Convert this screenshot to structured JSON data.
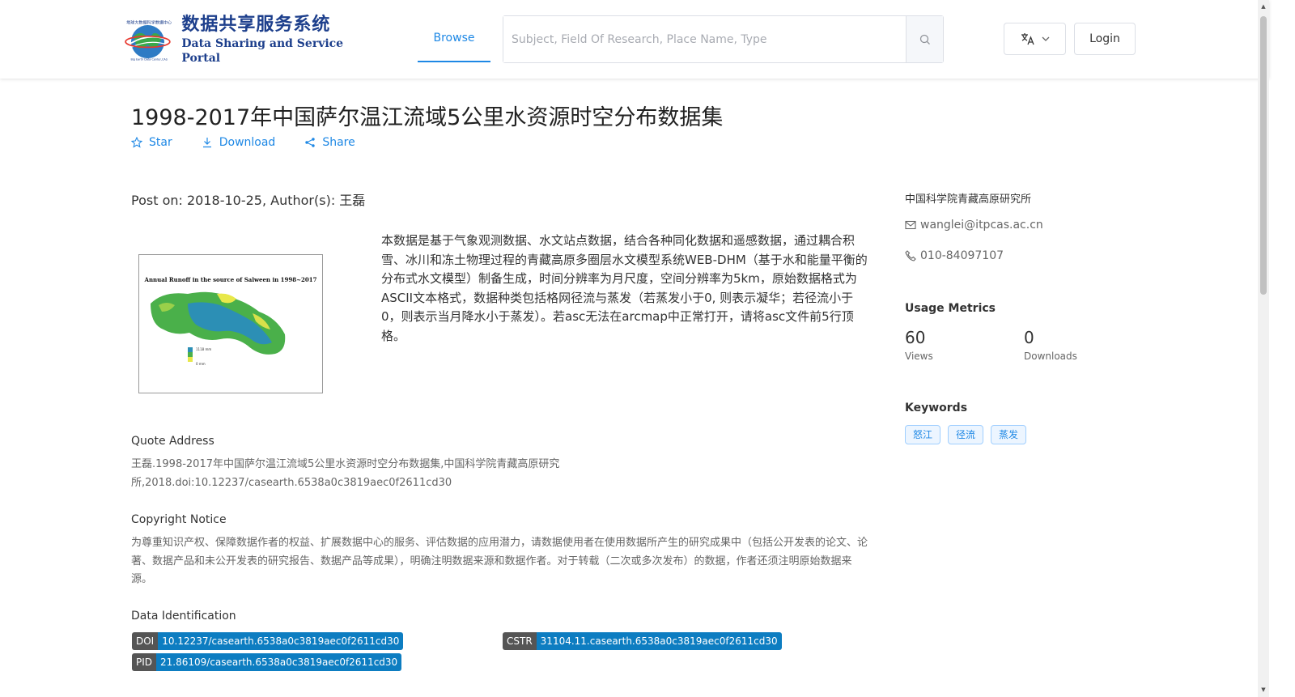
{
  "header": {
    "logo_cn": "数据共享服务系统",
    "logo_en": "Data Sharing and Service Portal",
    "logo_small_top": "地球大数据科学数据中心",
    "logo_small_bottom": "Big Earth Data Center,CAS",
    "nav_browse": "Browse",
    "search_placeholder": "Subject, Field Of Research, Place Name, Type",
    "login": "Login"
  },
  "dataset": {
    "title": "1998-2017年中国萨尔温江流域5公里水资源时空分布数据集",
    "actions": {
      "star": "Star",
      "download": "Download",
      "share": "Share"
    },
    "post_on": "Post on: 2018-10-25, Author(s): 王磊",
    "thumbnail": {
      "title": "Annual Runoff in the source of Salween in 1998~2017",
      "legend_high": "1118 mm",
      "legend_low": "0 mm"
    },
    "description": "本数据是基于气象观测数据、水文站点数据，结合各种同化数据和遥感数据，通过耦合积雪、冰川和冻土物理过程的青藏高原多圈层水文模型系统WEB-DHM（基于水和能量平衡的分布式水文模型）制备生成，时间分辨率为月尺度，空间分辨率为5km，原始数据格式为ASCII文本格式，数据种类包括格网径流与蒸发（若蒸发小于0, 则表示凝华；若径流小于0，则表示当月降水小于蒸发）。若asc无法在arcmap中正常打开，请将asc文件前5行顶格。"
  },
  "quote": {
    "heading": "Quote Address",
    "text": "王磊.1998-2017年中国萨尔温江流域5公里水资源时空分布数据集,中国科学院青藏高原研究所,2018.doi:10.12237/casearth.6538a0c3819aec0f2611cd30"
  },
  "copyright": {
    "heading": "Copyright Notice",
    "text": "为尊重知识产权、保障数据作者的权益、扩展数据中心的服务、评估数据的应用潜力，请数据使用者在使用数据所产生的研究成果中（包括公开发表的论文、论著、数据产品和未公开发表的研究报告、数据产品等成果），明确注明数据来源和数据作者。对于转载（二次或多次发布）的数据，作者还须注明原始数据来源。"
  },
  "identification": {
    "heading": "Data Identification",
    "doi_label": "DOI",
    "doi_value": "10.12237/casearth.6538a0c3819aec0f2611cd30",
    "cstr_label": "CSTR",
    "cstr_value": "31104.11.casearth.6538a0c3819aec0f2611cd30",
    "pid_label": "PID",
    "pid_value": "21.86109/casearth.6538a0c3819aec0f2611cd30"
  },
  "sidebar": {
    "organization": "中国科学院青藏高原研究所",
    "email": "wanglei@itpcas.ac.cn",
    "phone": "010-84097107",
    "usage_heading": "Usage Metrics",
    "views_value": "60",
    "views_label": "Views",
    "downloads_value": "0",
    "downloads_label": "Downloads",
    "keywords_heading": "Keywords",
    "keywords": [
      "怒江",
      "径流",
      "蒸发"
    ]
  },
  "colors": {
    "accent": "#1e88e5",
    "badge_label": "#555555",
    "badge_value": "#0d7dc1"
  }
}
